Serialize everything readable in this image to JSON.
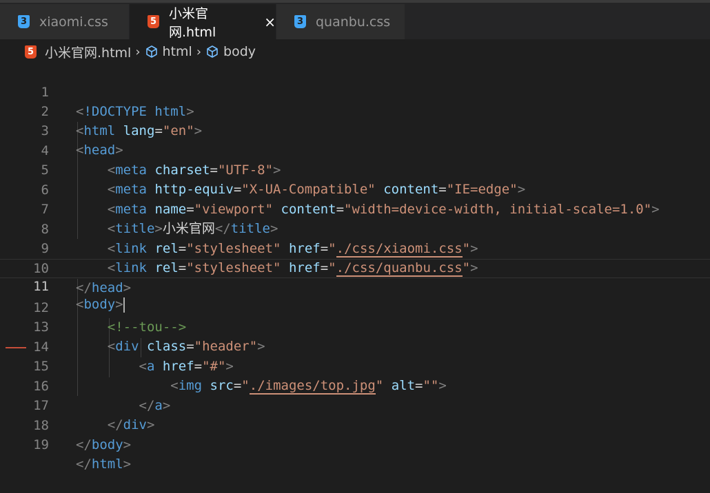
{
  "tabs": [
    {
      "label": "xiaomi.css",
      "type": "css",
      "active": false
    },
    {
      "label": "小米官网.html",
      "type": "html",
      "active": true
    },
    {
      "label": "quanbu.css",
      "type": "css",
      "active": false
    }
  ],
  "icons": {
    "css": "3",
    "html": "5",
    "close": "×"
  },
  "breadcrumb": {
    "file": "小米官网.html",
    "items": [
      "html",
      "body"
    ]
  },
  "editor": {
    "current_line": 11,
    "lines": [
      {
        "n": "1"
      },
      {
        "n": "2"
      },
      {
        "n": "3"
      },
      {
        "n": "4"
      },
      {
        "n": "5"
      },
      {
        "n": "6"
      },
      {
        "n": "7"
      },
      {
        "n": "8"
      },
      {
        "n": "9"
      },
      {
        "n": "10"
      },
      {
        "n": "11"
      },
      {
        "n": "12"
      },
      {
        "n": "13"
      },
      {
        "n": "14"
      },
      {
        "n": "15"
      },
      {
        "n": "16"
      },
      {
        "n": "17"
      },
      {
        "n": "18"
      },
      {
        "n": "19"
      }
    ],
    "code": {
      "doctype": "!DOCTYPE",
      "html": "html",
      "lang": "lang",
      "en": "\"en\"",
      "head": "head",
      "meta": "meta",
      "charset": "charset",
      "utf8": "\"UTF-8\"",
      "http_equiv": "http-equiv",
      "xua": "\"X-UA-Compatible\"",
      "content": "content",
      "ie_edge": "\"IE=edge\"",
      "name": "name",
      "viewport": "\"viewport\"",
      "vp_content": "\"width=device-width, initial-scale=1.0\"",
      "title": "title",
      "title_text": "小米官网",
      "link": "link",
      "rel": "rel",
      "stylesheet": "\"stylesheet\"",
      "href": "href",
      "href1": "./css/xiaomi.css",
      "href2": "./css/quanbu.css",
      "body": "body",
      "comment": "<!--tou-->",
      "div": "div",
      "class": "class",
      "header": "\"header\"",
      "a": "a",
      "hash": "\"#\"",
      "img": "img",
      "src": "src",
      "img_src": "./images/top.jpg",
      "alt": "alt",
      "empty": "\"\""
    }
  }
}
